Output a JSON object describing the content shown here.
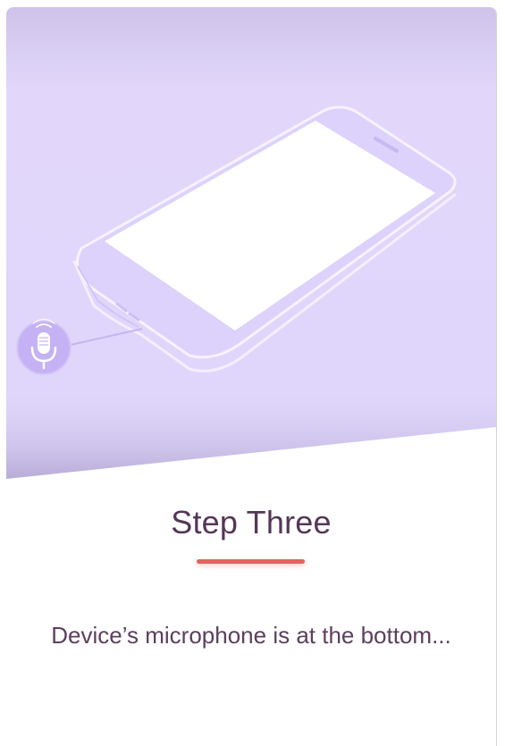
{
  "step": {
    "title": "Step Three",
    "description": "Device’s microphone is at the bottom..."
  },
  "illustration": {
    "phone_icon": "smartphone-icon",
    "mic_icon": "microphone-icon"
  },
  "colors": {
    "hero_background": "#e1d7fb",
    "title_text": "#553658",
    "accent_bar": "#e0655f",
    "description_text": "#5c3f5e",
    "mic_circle": "#c4b2f5"
  }
}
